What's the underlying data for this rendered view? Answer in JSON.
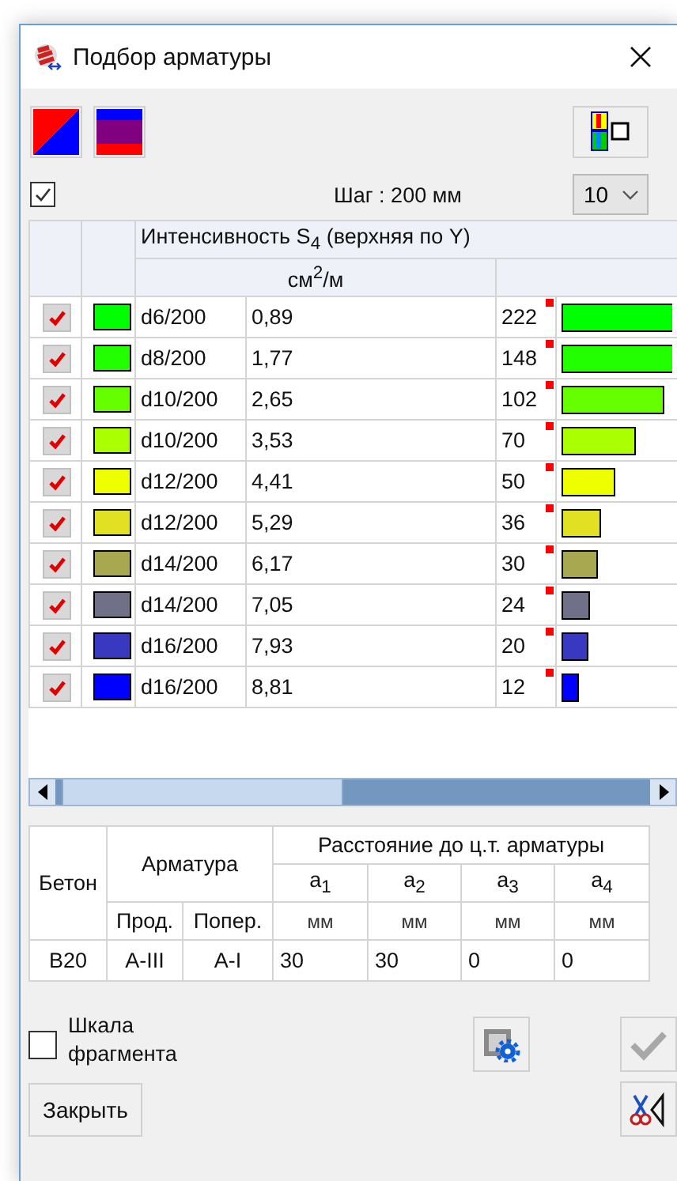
{
  "window": {
    "title": "Подбор арматуры"
  },
  "toolbar": {
    "show_checked": true,
    "step_label": "Шаг : 200 мм",
    "count_select": {
      "value": "10"
    }
  },
  "grid": {
    "group_header": "Интенсивность S$_{4}$ (верхняя по Y)",
    "unit_header": "см$^{2}$/м",
    "rows": [
      {
        "checked": true,
        "color": "#00ff00",
        "name": "d6/200",
        "area": "0,89",
        "count": "222",
        "level": 1
      },
      {
        "checked": true,
        "color": "#22ff00",
        "name": "d8/200",
        "area": "1,77",
        "count": "148",
        "level": 1
      },
      {
        "checked": true,
        "color": "#66ff00",
        "name": "d10/200",
        "area": "2,65",
        "count": "102",
        "level": 0.93
      },
      {
        "checked": true,
        "color": "#aaff00",
        "name": "d10/200",
        "area": "3,53",
        "count": "70",
        "level": 0.67
      },
      {
        "checked": true,
        "color": "#eeff00",
        "name": "d12/200",
        "area": "4,41",
        "count": "50",
        "level": 0.49
      },
      {
        "checked": true,
        "color": "#e2e022",
        "name": "d12/200",
        "area": "5,29",
        "count": "36",
        "level": 0.36
      },
      {
        "checked": true,
        "color": "#a8a850",
        "name": "d14/200",
        "area": "6,17",
        "count": "30",
        "level": 0.33
      },
      {
        "checked": true,
        "color": "#707088",
        "name": "d14/200",
        "area": "7,05",
        "count": "24",
        "level": 0.26
      },
      {
        "checked": true,
        "color": "#3838c0",
        "name": "d16/200",
        "area": "7,93",
        "count": "20",
        "level": 0.24
      },
      {
        "checked": true,
        "color": "#0000ff",
        "name": "d16/200",
        "area": "8,81",
        "count": "12",
        "level": 0.16
      }
    ]
  },
  "reinforcement_table": {
    "headers": {
      "concrete": "Бетон",
      "rebar": "Арматура",
      "distance": "Расстояние до ц.т. арматуры",
      "longitudinal": "Прод.",
      "transverse": "Попер.",
      "distances": [
        {
          "label": "a$_{1}$",
          "unit": "мм"
        },
        {
          "label": "a$_{2}$",
          "unit": "мм"
        },
        {
          "label": "a$_{3}$",
          "unit": "мм"
        },
        {
          "label": "a$_{4}$",
          "unit": "мм"
        }
      ]
    },
    "row": {
      "concrete": "В20",
      "longitudinal": "А-III",
      "transverse": "А-I",
      "distances": [
        "30",
        "30",
        "0",
        "0"
      ]
    }
  },
  "footer": {
    "fragment_scale": {
      "label": "Шкала фрагмента",
      "checked": false
    },
    "close_button": "Закрыть",
    "apply": {
      "disabled": true
    }
  }
}
